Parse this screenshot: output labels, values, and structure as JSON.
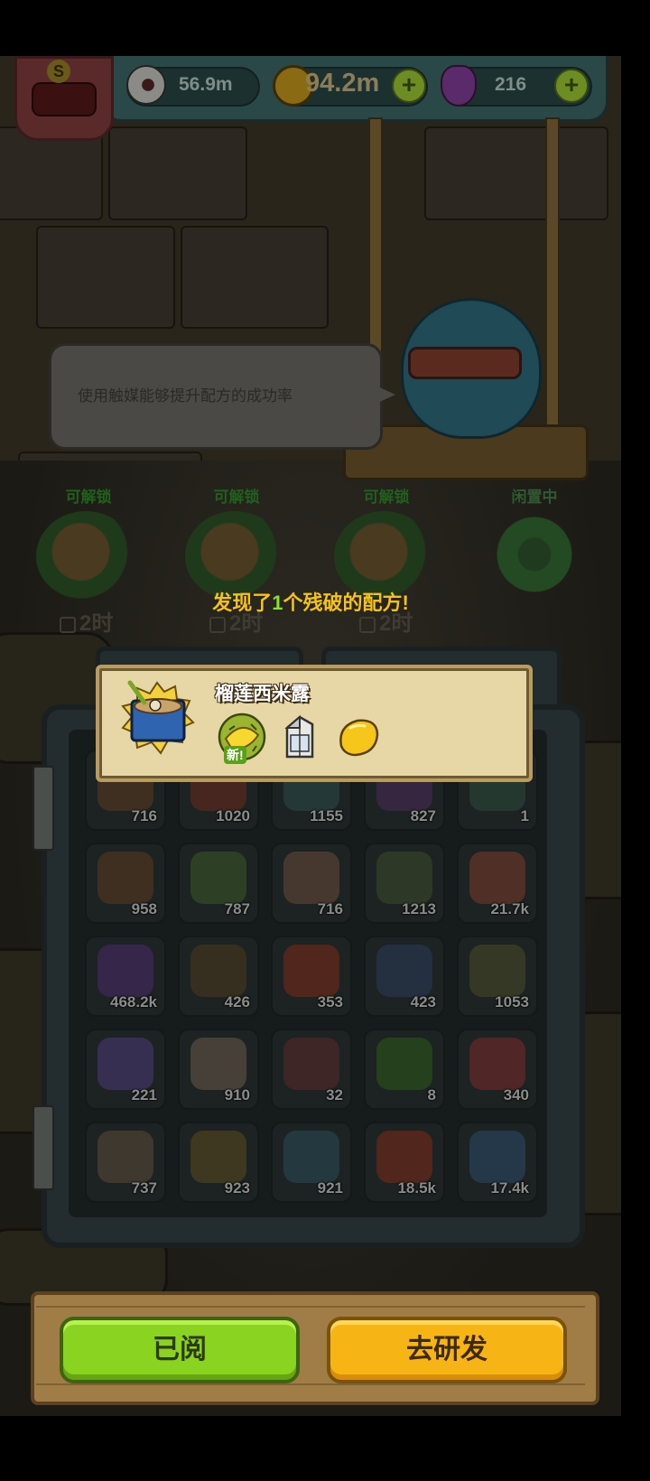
{
  "hud": {
    "eye_value": "56.9m",
    "coin_value": "94.2m",
    "potion_value": "216",
    "plus_symbol": "+"
  },
  "badge": {
    "letter": "S"
  },
  "speech": {
    "text": "使用触媒能够提升配方的成功率"
  },
  "slots": [
    {
      "label": "可解锁",
      "timer": "2时"
    },
    {
      "label": "可解锁",
      "timer": "2时"
    },
    {
      "label": "可解锁",
      "timer": "2时"
    },
    {
      "label": "闲置中",
      "timer": ""
    }
  ],
  "discovery": {
    "prefix": "发现了",
    "count": "1",
    "suffix": "个残破的配方!"
  },
  "popup": {
    "recipe_name": "榴莲西米露",
    "new_tag": "新!",
    "ingredients": [
      "durian-icon",
      "milk-carton-icon",
      "mango-icon"
    ]
  },
  "inventory": {
    "rows": [
      [
        "716",
        "1020",
        "1155",
        "827",
        "1"
      ],
      [
        "958",
        "787",
        "716",
        "1213",
        "21.7k"
      ],
      [
        "468.2k",
        "426",
        "353",
        "423",
        "1053"
      ],
      [
        "221",
        "910",
        "32",
        "8",
        "340"
      ],
      [
        "737",
        "923",
        "921",
        "18.5k",
        "17.4k"
      ]
    ],
    "art_colors": [
      [
        "#5a3a1f",
        "#6a2a1f",
        "#2a4a4a",
        "#4a2a5a",
        "#2a4a3a"
      ],
      [
        "#5a3a1f",
        "#3a5a2a",
        "#6a4a3a",
        "#3a4a2a",
        "#7a3a2a"
      ],
      [
        "#4a2a6a",
        "#4a3a1f",
        "#7a2a1a",
        "#2a3a5a",
        "#4a4a2a"
      ],
      [
        "#4a3a7a",
        "#6a5a4a",
        "#5a2a2a",
        "#2a5a1a",
        "#7a2a2a"
      ],
      [
        "#5a4a3a",
        "#5a4a1f",
        "#2a4a5a",
        "#7a2a1a",
        "#2a4a6a"
      ]
    ]
  },
  "buttons": {
    "read": "已阅",
    "develop": "去研发"
  },
  "colors": {
    "gold_text": "#f4c21b",
    "green_count": "#8ee02a",
    "read_button": "#8ad320",
    "develop_button": "#f7b515"
  }
}
